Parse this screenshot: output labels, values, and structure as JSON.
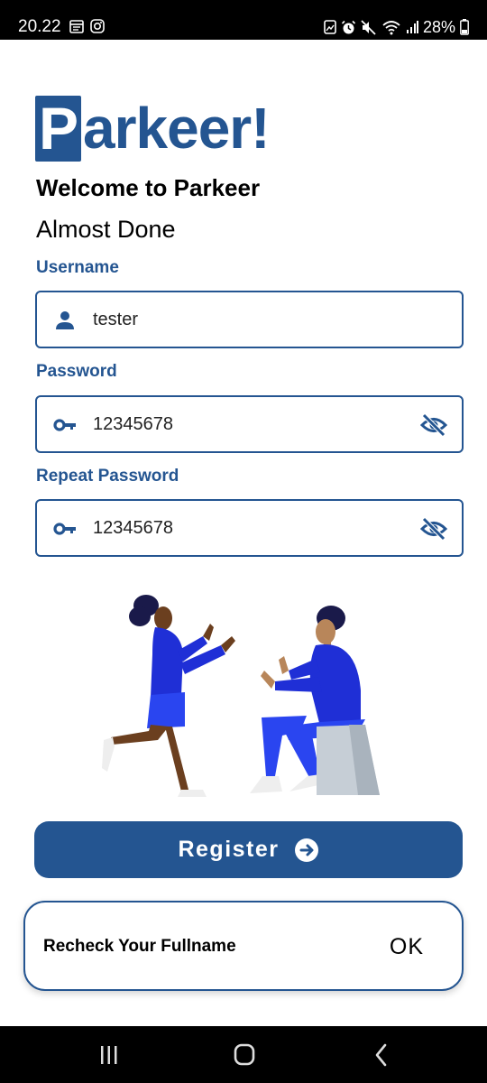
{
  "status_bar": {
    "time": "20.22",
    "battery": "28%",
    "icons": [
      "calendar-icon",
      "instagram-icon",
      "photo-icon",
      "alarm-icon",
      "mute-icon",
      "wifi-icon",
      "signal-icon",
      "battery-icon"
    ]
  },
  "brand": {
    "logo_first_letter": "P",
    "logo_rest": "arkeer!",
    "color": "#245591"
  },
  "header": {
    "welcome": "Welcome to Parkeer",
    "subtitle": "Almost Done"
  },
  "form": {
    "username": {
      "label": "Username",
      "value": "tester",
      "icon": "person-icon"
    },
    "password": {
      "label": "Password",
      "value": "12345678",
      "icon": "key-icon",
      "toggle_icon": "eye-off-icon"
    },
    "repeat_password": {
      "label": "Repeat Password",
      "value": "12345678",
      "icon": "key-icon",
      "toggle_icon": "eye-off-icon"
    }
  },
  "register_button": {
    "label": "Register",
    "icon": "arrow-right-circle-icon"
  },
  "snackbar": {
    "message": "Recheck Your Fullname",
    "action": "OK"
  },
  "nav": {
    "icons": [
      "recent-apps-icon",
      "home-icon",
      "back-icon"
    ]
  }
}
